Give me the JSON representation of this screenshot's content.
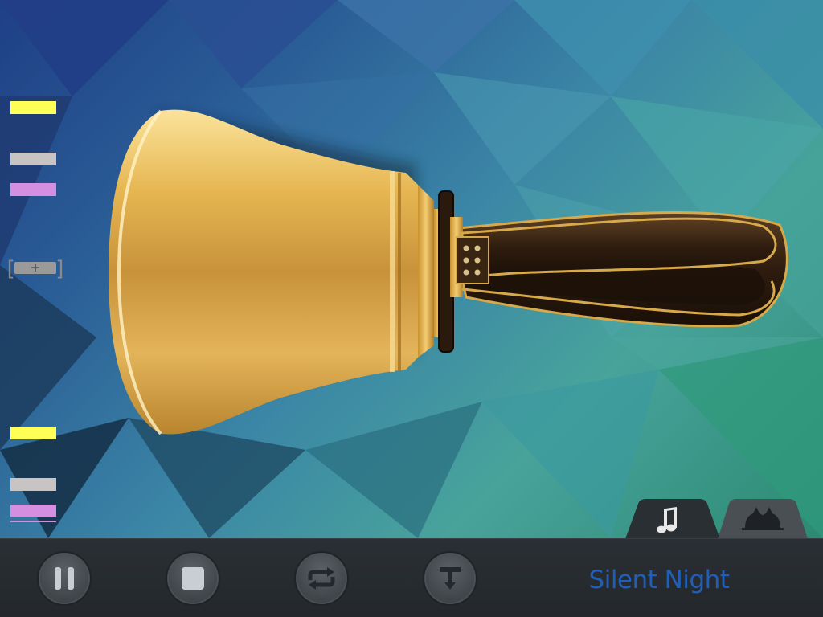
{
  "markers": {
    "upper": [
      {
        "color": "#ffff55",
        "label": "yellow"
      },
      {
        "color": "#c8c4c4",
        "label": "grey"
      },
      {
        "color": "#d58fe0",
        "label": "purple"
      }
    ],
    "lower": [
      {
        "color": "#ffff55",
        "label": "yellow"
      },
      {
        "color": "#c8c4c4",
        "label": "grey"
      },
      {
        "color": "#d58fe0",
        "label": "purple"
      }
    ],
    "add_symbol": "+",
    "bracket_left": "[",
    "bracket_right": "]"
  },
  "tabs": {
    "music_icon": "music-note-icon",
    "bells_icon": "handbells-icon"
  },
  "controls": {
    "pause_icon": "pause-icon",
    "stop_icon": "stop-icon",
    "repeat_icon": "repeat-icon",
    "tempo_icon": "tempo-icon"
  },
  "song": {
    "title": "Silent Night"
  },
  "colors": {
    "accent": "#1f5fb7",
    "bar": "#272b2f",
    "bell_gold": "#d9a53b"
  }
}
